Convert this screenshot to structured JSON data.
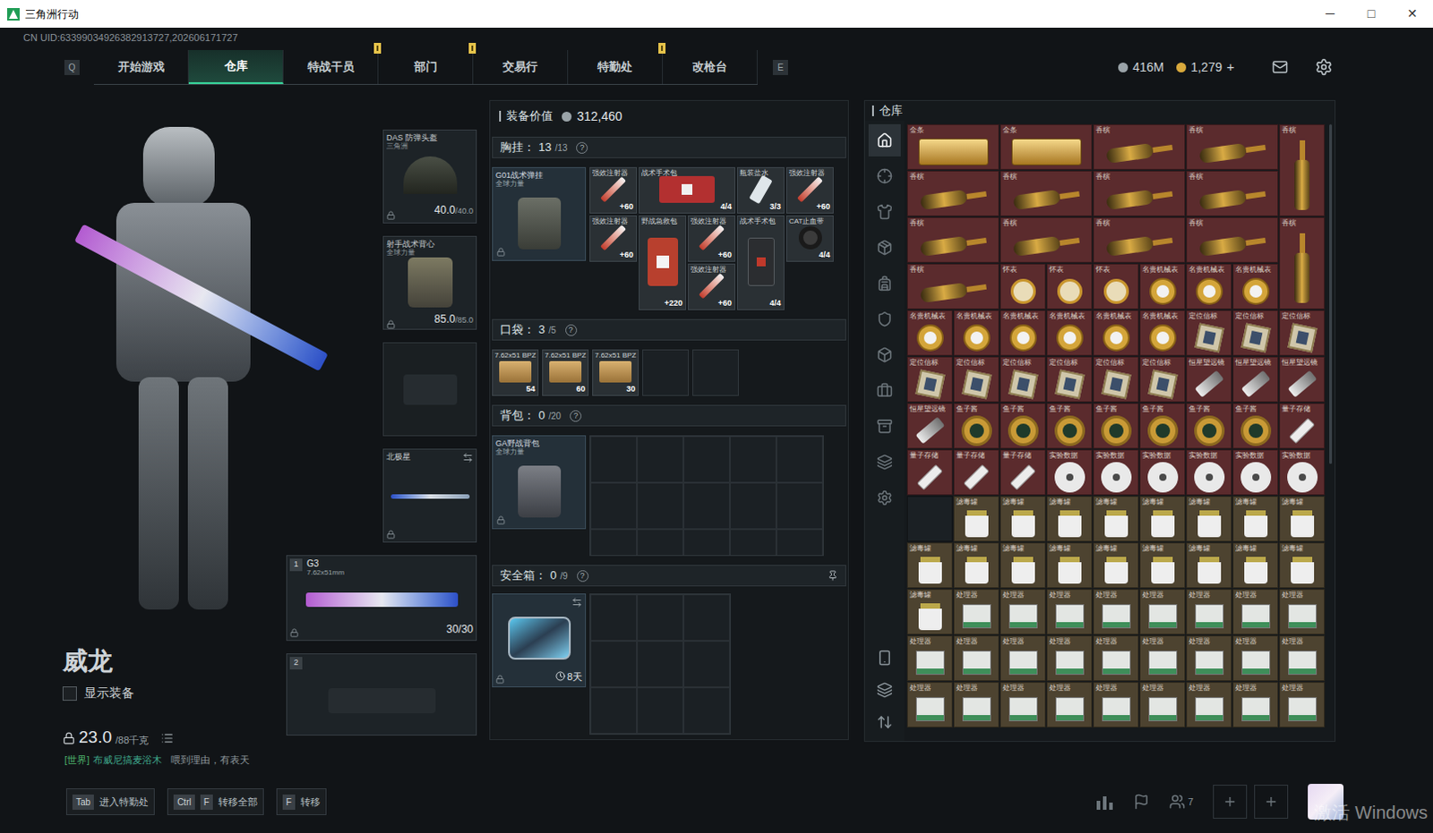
{
  "window": {
    "title": "三角洲行动",
    "controls": [
      "─",
      "□",
      "✕"
    ]
  },
  "uid": "CN UID:63399034926382913727,202606171727",
  "nav": {
    "prev_key": "Q",
    "next_key": "E",
    "tabs": [
      {
        "label": "开始游戏",
        "selected": false,
        "badge": false
      },
      {
        "label": "仓库",
        "selected": true,
        "badge": false
      },
      {
        "label": "特战干员",
        "selected": false,
        "badge": true
      },
      {
        "label": "部门",
        "selected": false,
        "badge": true
      },
      {
        "label": "交易行",
        "selected": false,
        "badge": false
      },
      {
        "label": "特勤处",
        "selected": false,
        "badge": true
      },
      {
        "label": "改枪台",
        "selected": false,
        "badge": false
      }
    ]
  },
  "currency": [
    {
      "value": "416M",
      "add": "",
      "color": "#9aa3a8"
    },
    {
      "value": "1,279",
      "add": "+",
      "color": "#d9a93c"
    }
  ],
  "character": {
    "name": "威龙",
    "show_gear": {
      "label": "显示装备",
      "checked": false
    },
    "weight": "23.0",
    "weight_max": "/88千克"
  },
  "chat": {
    "channel": "[世界]",
    "sender": "布威尼搞麦浴木",
    "message": "喂到理由，有表天"
  },
  "slots": {
    "helmet": {
      "name": "DAS 防弹头盔",
      "sub": "三角洲",
      "durability": "40.0",
      "durability_max": "/40.0"
    },
    "armor": {
      "name": "射手战术背心",
      "sub": "全球力量",
      "durability": "85.0",
      "durability_max": "/85.0"
    },
    "melee": {
      "name": "北极星"
    },
    "weapons": [
      {
        "index": "1",
        "name": "G3",
        "caliber": "7.62x51mm",
        "ammo": "30/30",
        "empty": false
      },
      {
        "index": "2",
        "name": "",
        "caliber": "",
        "ammo": "",
        "empty": true
      }
    ]
  },
  "loadout": {
    "label": "装备价值",
    "value": "312,460",
    "chest": {
      "label": "胸挂：",
      "count": "13",
      "capacity": "/13",
      "help": "?",
      "container": {
        "name": "G01战术弹挂",
        "sub": "全球力量"
      },
      "items": [
        {
          "name": "强效注射器",
          "count": "+60",
          "kind": "injector"
        },
        {
          "name": "战术手术包",
          "count": "4/4",
          "kind": "kit-wide"
        },
        {
          "name": "瓶装盐水",
          "count": "3/3",
          "kind": "saline"
        },
        {
          "name": "强效注射器",
          "count": "+60",
          "kind": "injector"
        },
        {
          "name": "强效注射器",
          "count": "+60",
          "kind": "injector"
        },
        {
          "name": "野战急救包",
          "count": "+220",
          "kind": "medkit-tall"
        },
        {
          "name": "强效注射器",
          "count": "+60",
          "kind": "injector"
        },
        {
          "name": "战术手术包",
          "count": "4/4",
          "kind": "kit-tall"
        },
        {
          "name": "CAT止血带",
          "count": "4/4",
          "kind": "tourniquet"
        },
        {
          "name": "",
          "count": "",
          "kind": "empty"
        },
        {
          "name": "强效注射器",
          "count": "+60",
          "kind": "injector"
        }
      ]
    },
    "pocket": {
      "label": "口袋：",
      "count": "3",
      "capacity": "/5",
      "help": "?",
      "items": [
        {
          "name": "7.62x51 BPZ",
          "count": "54",
          "kind": "ammo"
        },
        {
          "name": "7.62x51 BPZ",
          "count": "60",
          "kind": "ammo"
        },
        {
          "name": "7.62x51 BPZ",
          "count": "30",
          "kind": "ammo"
        },
        {
          "name": "",
          "count": "",
          "kind": "empty"
        },
        {
          "name": "",
          "count": "",
          "kind": "empty"
        }
      ]
    },
    "backpack": {
      "label": "背包：",
      "count": "0",
      "capacity": "/20",
      "help": "?",
      "container": {
        "name": "GA野战背包",
        "sub": "全球力量"
      },
      "cells": 20
    },
    "safe": {
      "label": "安全箱：",
      "count": "0",
      "capacity": "/9",
      "help": "?",
      "timer": "8天",
      "cells": 9
    }
  },
  "warehouse": {
    "title": "仓库",
    "tabs": [
      {
        "selected": true
      },
      {
        "selected": false
      },
      {
        "selected": false
      },
      {
        "selected": false
      },
      {
        "selected": false
      },
      {
        "selected": false
      },
      {
        "selected": false
      },
      {
        "selected": false
      },
      {
        "selected": false
      },
      {
        "selected": false
      },
      {
        "selected": false
      }
    ],
    "items": [
      {
        "name": "金条",
        "kind": "bar-wide",
        "color": "#5b2b2d"
      },
      {
        "name": "金条",
        "kind": "bar-wide",
        "color": "#5b2b2d"
      },
      {
        "name": "香槟",
        "kind": "bottle-wide",
        "color": "#5b2b2d"
      },
      {
        "name": "香槟",
        "kind": "bottle-wide",
        "color": "#5b2b2d"
      },
      {
        "name": "香槟",
        "kind": "bottle-tall",
        "color": "#5b2b2d"
      },
      {
        "name": "香槟",
        "kind": "bottle-wide",
        "color": "#5b2b2d"
      },
      {
        "name": "香槟",
        "kind": "bottle-wide",
        "color": "#5b2b2d"
      },
      {
        "name": "香槟",
        "kind": "bottle-wide",
        "color": "#5b2b2d"
      },
      {
        "name": "香槟",
        "kind": "bottle-wide",
        "color": "#5b2b2d"
      },
      {
        "name": "香槟",
        "kind": "bottle-wide",
        "color": "#5b2b2d"
      },
      {
        "name": "香槟",
        "kind": "bottle-wide",
        "color": "#5b2b2d"
      },
      {
        "name": "香槟",
        "kind": "bottle-wide",
        "color": "#5b2b2d"
      },
      {
        "name": "香槟",
        "kind": "bottle-wide",
        "color": "#5b2b2d"
      },
      {
        "name": "香槟",
        "kind": "bottle-tall",
        "color": "#5b2b2d"
      },
      {
        "name": "香槟",
        "kind": "bottle-wide",
        "color": "#5b2b2d"
      },
      {
        "name": "怀表",
        "kind": "watch",
        "color": "#5b2b2d"
      },
      {
        "name": "怀表",
        "kind": "watch",
        "color": "#5b2b2d"
      },
      {
        "name": "怀表",
        "kind": "watch",
        "color": "#5b2b2d"
      },
      {
        "name": "名贵机械表",
        "kind": "luxury-watch",
        "color": "#5b2b2d"
      },
      {
        "name": "名贵机械表",
        "kind": "luxury-watch",
        "color": "#5b2b2d"
      },
      {
        "name": "名贵机械表",
        "kind": "luxury-watch",
        "color": "#5b2b2d"
      },
      {
        "name": "名贵机械表",
        "kind": "luxury-watch",
        "color": "#5b2b2d"
      },
      {
        "name": "名贵机械表",
        "kind": "luxury-watch",
        "color": "#5b2b2d"
      },
      {
        "name": "名贵机械表",
        "kind": "luxury-watch",
        "color": "#5b2b2d"
      },
      {
        "name": "名贵机械表",
        "kind": "luxury-watch",
        "color": "#5b2b2d"
      },
      {
        "name": "名贵机械表",
        "kind": "luxury-watch",
        "color": "#5b2b2d"
      },
      {
        "name": "名贵机械表",
        "kind": "luxury-watch",
        "color": "#5b2b2d"
      },
      {
        "name": "定位信标",
        "kind": "beacon",
        "color": "#5b2b2d"
      },
      {
        "name": "定位信标",
        "kind": "beacon",
        "color": "#5b2b2d"
      },
      {
        "name": "定位信标",
        "kind": "beacon",
        "color": "#5b2b2d"
      },
      {
        "name": "定位信标",
        "kind": "beacon",
        "color": "#5b2b2d"
      },
      {
        "name": "定位信标",
        "kind": "beacon",
        "color": "#5b2b2d"
      },
      {
        "name": "定位信标",
        "kind": "beacon",
        "color": "#5b2b2d"
      },
      {
        "name": "定位信标",
        "kind": "beacon",
        "color": "#5b2b2d"
      },
      {
        "name": "定位信标",
        "kind": "beacon",
        "color": "#5b2b2d"
      },
      {
        "name": "定位信标",
        "kind": "beacon",
        "color": "#5b2b2d"
      },
      {
        "name": "恒星望远镜",
        "kind": "scope",
        "color": "#5b2b2d"
      },
      {
        "name": "恒星望远镜",
        "kind": "scope",
        "color": "#5b2b2d"
      },
      {
        "name": "恒星望远镜",
        "kind": "scope",
        "color": "#5b2b2d"
      },
      {
        "name": "恒星望远镜",
        "kind": "scope",
        "color": "#5b2b2d"
      },
      {
        "name": "鱼子酱",
        "kind": "caviar",
        "color": "#5b2b2d"
      },
      {
        "name": "鱼子酱",
        "kind": "caviar",
        "color": "#5b2b2d"
      },
      {
        "name": "鱼子酱",
        "kind": "caviar",
        "color": "#5b2b2d"
      },
      {
        "name": "鱼子酱",
        "kind": "caviar",
        "color": "#5b2b2d"
      },
      {
        "name": "鱼子酱",
        "kind": "caviar",
        "color": "#5b2b2d"
      },
      {
        "name": "鱼子酱",
        "kind": "caviar",
        "color": "#5b2b2d"
      },
      {
        "name": "鱼子酱",
        "kind": "caviar",
        "color": "#5b2b2d"
      },
      {
        "name": "量子存储",
        "kind": "drive",
        "color": "#5b2b2d"
      },
      {
        "name": "量子存储",
        "kind": "drive",
        "color": "#5b2b2d"
      },
      {
        "name": "量子存储",
        "kind": "drive",
        "color": "#5b2b2d"
      },
      {
        "name": "量子存储",
        "kind": "drive",
        "color": "#5b2b2d"
      },
      {
        "name": "实验数据",
        "kind": "disc",
        "color": "#5b2b2d"
      },
      {
        "name": "实验数据",
        "kind": "disc",
        "color": "#5b2b2d"
      },
      {
        "name": "实验数据",
        "kind": "disc",
        "color": "#5b2b2d"
      },
      {
        "name": "实验数据",
        "kind": "disc",
        "color": "#5b2b2d"
      },
      {
        "name": "实验数据",
        "kind": "disc",
        "color": "#5b2b2d"
      },
      {
        "name": "实验数据",
        "kind": "disc",
        "color": "#5b2b2d"
      },
      {
        "name": "",
        "kind": "empty",
        "color": "#1b2024"
      },
      {
        "name": "滤毒罐",
        "kind": "filter",
        "color": "#4d4330"
      },
      {
        "name": "滤毒罐",
        "kind": "filter",
        "color": "#4d4330"
      },
      {
        "name": "滤毒罐",
        "kind": "filter",
        "color": "#4d4330"
      },
      {
        "name": "滤毒罐",
        "kind": "filter",
        "color": "#4d4330"
      },
      {
        "name": "滤毒罐",
        "kind": "filter",
        "color": "#4d4330"
      },
      {
        "name": "滤毒罐",
        "kind": "filter",
        "color": "#4d4330"
      },
      {
        "name": "滤毒罐",
        "kind": "filter",
        "color": "#4d4330"
      },
      {
        "name": "滤毒罐",
        "kind": "filter",
        "color": "#4d4330"
      },
      {
        "name": "滤毒罐",
        "kind": "filter",
        "color": "#4d4330"
      },
      {
        "name": "滤毒罐",
        "kind": "filter",
        "color": "#4d4330"
      },
      {
        "name": "滤毒罐",
        "kind": "filter",
        "color": "#4d4330"
      },
      {
        "name": "滤毒罐",
        "kind": "filter",
        "color": "#4d4330"
      },
      {
        "name": "滤毒罐",
        "kind": "filter",
        "color": "#4d4330"
      },
      {
        "name": "滤毒罐",
        "kind": "filter",
        "color": "#4d4330"
      },
      {
        "name": "滤毒罐",
        "kind": "filter",
        "color": "#4d4330"
      },
      {
        "name": "滤毒罐",
        "kind": "filter",
        "color": "#4d4330"
      },
      {
        "name": "滤毒罐",
        "kind": "filter",
        "color": "#4d4330"
      },
      {
        "name": "滤毒罐",
        "kind": "filter",
        "color": "#4d4330"
      },
      {
        "name": "处理器",
        "kind": "processor",
        "color": "#4d4330"
      },
      {
        "name": "处理器",
        "kind": "processor",
        "color": "#4d4330"
      },
      {
        "name": "处理器",
        "kind": "processor",
        "color": "#4d4330"
      },
      {
        "name": "处理器",
        "kind": "processor",
        "color": "#4d4330"
      },
      {
        "name": "处理器",
        "kind": "processor",
        "color": "#4d4330"
      },
      {
        "name": "处理器",
        "kind": "processor",
        "color": "#4d4330"
      },
      {
        "name": "处理器",
        "kind": "processor",
        "color": "#4d4330"
      },
      {
        "name": "处理器",
        "kind": "processor",
        "color": "#4d4330"
      },
      {
        "name": "处理器",
        "kind": "processor",
        "color": "#4d4330"
      },
      {
        "name": "处理器",
        "kind": "processor",
        "color": "#4d4330"
      },
      {
        "name": "处理器",
        "kind": "processor",
        "color": "#4d4330"
      },
      {
        "name": "处理器",
        "kind": "processor",
        "color": "#4d4330"
      },
      {
        "name": "处理器",
        "kind": "processor",
        "color": "#4d4330"
      },
      {
        "name": "处理器",
        "kind": "processor",
        "color": "#4d4330"
      },
      {
        "name": "处理器",
        "kind": "processor",
        "color": "#4d4330"
      },
      {
        "name": "处理器",
        "kind": "processor",
        "color": "#4d4330"
      },
      {
        "name": "处理器",
        "kind": "processor",
        "color": "#4d4330"
      },
      {
        "name": "处理器",
        "kind": "processor",
        "color": "#4d4330"
      },
      {
        "name": "处理器",
        "kind": "processor",
        "color": "#4d4330"
      },
      {
        "name": "处理器",
        "kind": "processor",
        "color": "#4d4330"
      },
      {
        "name": "处理器",
        "kind": "processor",
        "color": "#4d4330"
      },
      {
        "name": "处理器",
        "kind": "processor",
        "color": "#4d4330"
      },
      {
        "name": "处理器",
        "kind": "processor",
        "color": "#4d4330"
      },
      {
        "name": "处理器",
        "kind": "processor",
        "color": "#4d4330"
      },
      {
        "name": "处理器",
        "kind": "processor",
        "color": "#4d4330"
      },
      {
        "name": "处理器",
        "kind": "processor",
        "color": "#4d4330"
      }
    ]
  },
  "bottom_bar": {
    "hints": [
      {
        "keys": [
          "Tab"
        ],
        "label": "进入特勤处"
      },
      {
        "keys": [
          "Ctrl",
          "F"
        ],
        "label": "转移全部"
      },
      {
        "keys": [
          "F"
        ],
        "label": "转移"
      }
    ],
    "friends": "7",
    "watermark": "激活 Windows"
  }
}
